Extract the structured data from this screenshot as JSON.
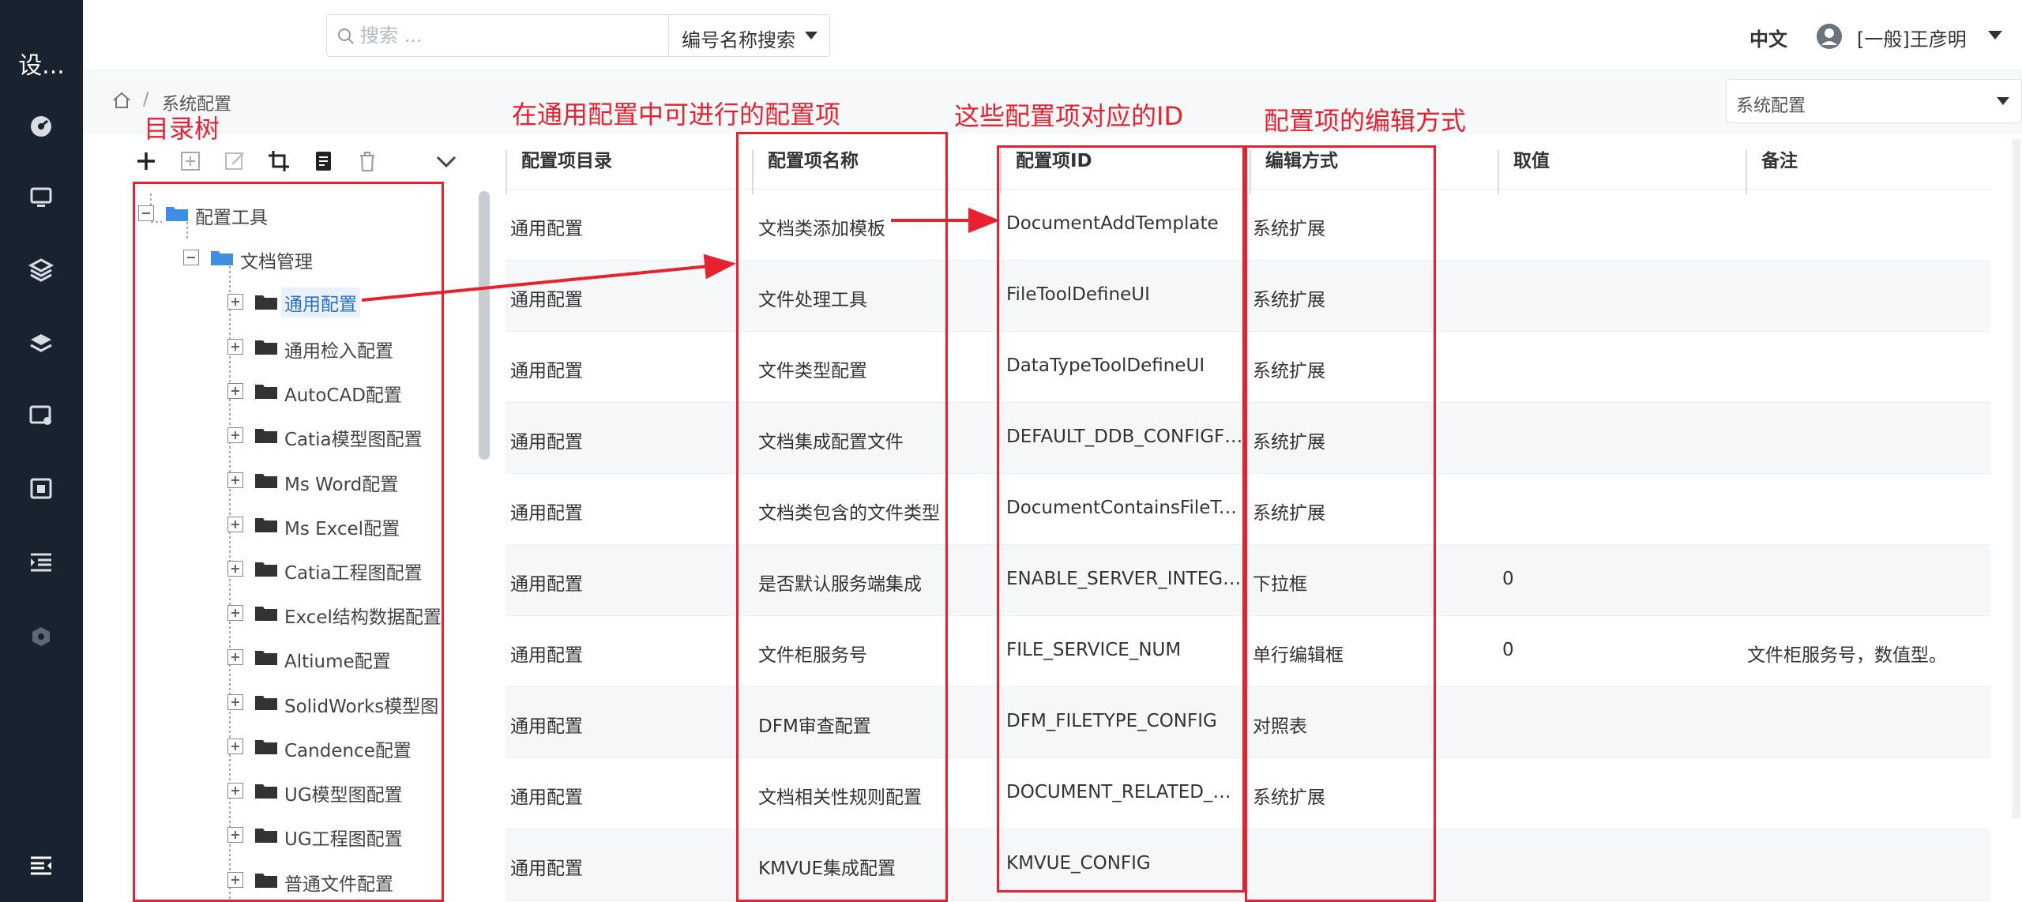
{
  "nav": {
    "title": "设...",
    "icons": [
      "dashboard-icon",
      "monitor-icon",
      "layers-icon",
      "stack-icon",
      "settings-screen-icon",
      "calendar-icon",
      "indent-list-icon",
      "shield-icon",
      "menu-toggle-icon"
    ]
  },
  "header": {
    "search_placeholder": "搜索 ...",
    "search_mode": "编号名称搜索",
    "lang": "中文",
    "user": "[一般]王彦明"
  },
  "breadcrumb": {
    "current": "系统配置",
    "separator": "/"
  },
  "module_select": {
    "value": "系统配置"
  },
  "tree": {
    "root": "配置工具",
    "child": "文档管理",
    "items": [
      "通用配置",
      "通用检入配置",
      "AutoCAD配置",
      "Catia模型图配置",
      "Ms Word配置",
      "Ms Excel配置",
      "Catia工程图配置",
      "Excel结构数据配置",
      "Altiume配置",
      "SolidWorks模型图",
      "Candence配置",
      "UG模型图配置",
      "UG工程图配置",
      "普通文件配置"
    ],
    "selected_index": 0
  },
  "table": {
    "columns": [
      "配置项目录",
      "配置项名称",
      "配置项ID",
      "编辑方式",
      "取值",
      "备注"
    ],
    "rows": [
      [
        "通用配置",
        "文档类添加模板",
        "DocumentAddTemplate",
        "系统扩展",
        "",
        ""
      ],
      [
        "通用配置",
        "文件处理工具",
        "FileToolDefineUI",
        "系统扩展",
        "",
        ""
      ],
      [
        "通用配置",
        "文件类型配置",
        "DataTypeToolDefineUI",
        "系统扩展",
        "",
        ""
      ],
      [
        "通用配置",
        "文档集成配置文件",
        "DEFAULT_DDB_CONFIGFILE",
        "系统扩展",
        "",
        ""
      ],
      [
        "通用配置",
        "文档类包含的文件类型",
        "DocumentContainsFileTyp...",
        "系统扩展",
        "",
        ""
      ],
      [
        "通用配置",
        "是否默认服务端集成",
        "ENABLE_SERVER_INTEGR...",
        "下拉框",
        "0",
        ""
      ],
      [
        "通用配置",
        "文件柜服务号",
        "FILE_SERVICE_NUM",
        "单行编辑框",
        "0",
        "文件柜服务号，数值型。"
      ],
      [
        "通用配置",
        "DFM审查配置",
        "DFM_FILETYPE_CONFIG",
        "对照表",
        "",
        ""
      ],
      [
        "通用配置",
        "文档相关性规则配置",
        "DOCUMENT_RELATED_RU...",
        "系统扩展",
        "",
        ""
      ],
      [
        "通用配置",
        "KMVUE集成配置",
        "KMVUE_CONFIG",
        "",
        "",
        ""
      ]
    ]
  },
  "annotations": {
    "tree_label": "目录树",
    "names_label": "在通用配置中可进行的配置项",
    "ids_label": "这些配置项对应的ID",
    "edit_label": "配置项的编辑方式",
    "color": "#e8212e"
  }
}
